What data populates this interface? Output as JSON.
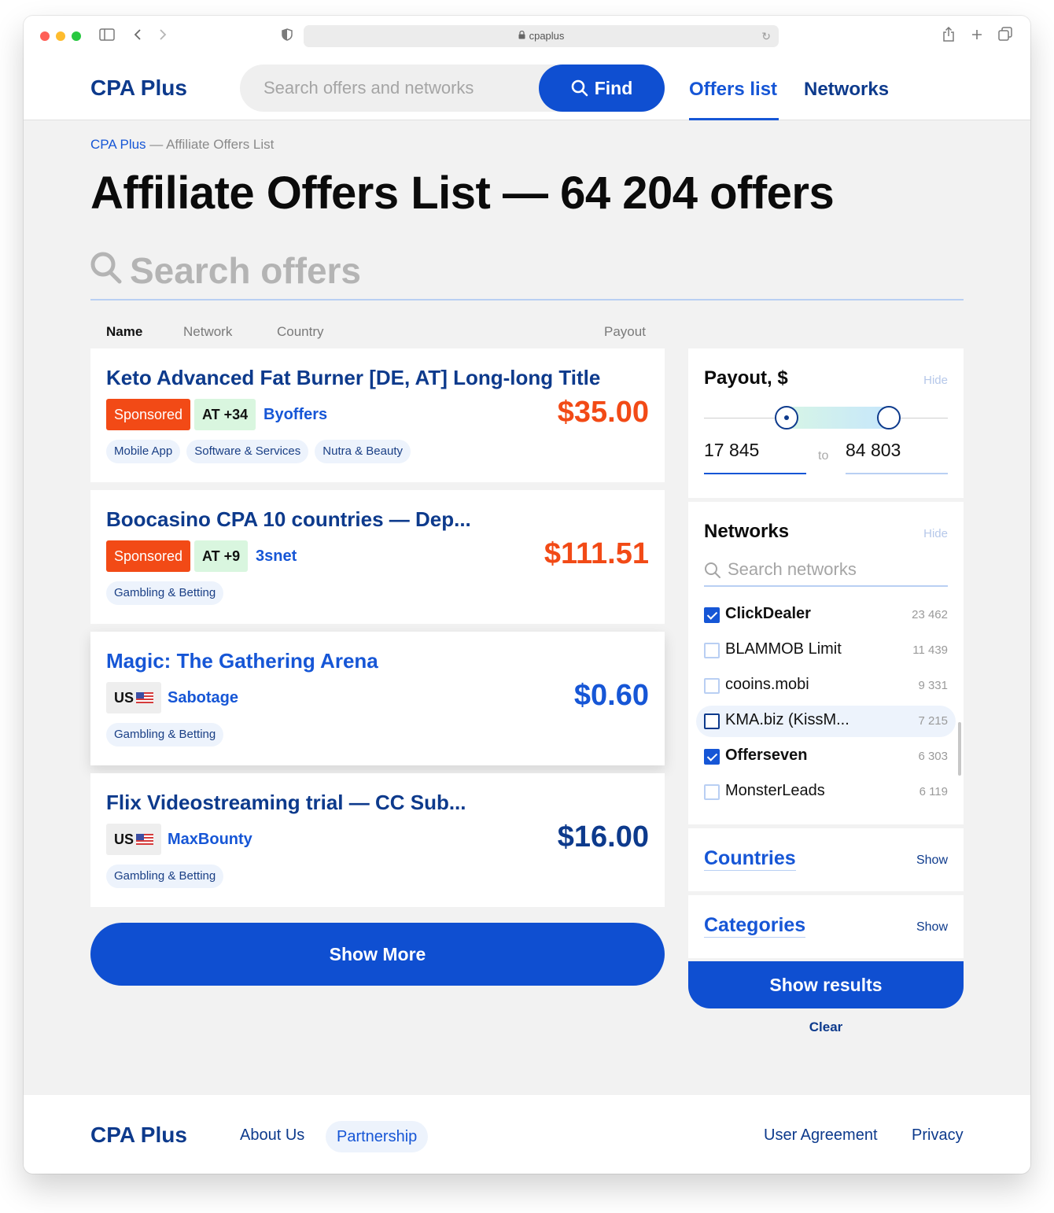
{
  "browser": {
    "url": "cpaplus",
    "traffic_colors": [
      "#ff5f57",
      "#febc2e",
      "#28c840"
    ]
  },
  "header": {
    "logo": "CPA Plus",
    "search_placeholder": "Search offers and networks",
    "find_label": "Find",
    "nav": [
      {
        "label": "Offers list",
        "active": true
      },
      {
        "label": "Networks",
        "active": false
      }
    ]
  },
  "breadcrumb": {
    "home": "CPA Plus",
    "current": " — Affiliate Offers List"
  },
  "page": {
    "title": "Affiliate Offers List — 64 204 offers",
    "search_placeholder": "Search offers"
  },
  "sort_columns": [
    "Name",
    "Network",
    "Country",
    "Payout"
  ],
  "offers": [
    {
      "title": "Keto Advanced Fat Burner [DE, AT] Long-long Title",
      "sponsored": "Sponsored",
      "geo": "AT +34",
      "network": "Byoffers",
      "payout": "$35.00",
      "tags": [
        "Mobile App",
        "Software & Services",
        "Nutra & Beauty"
      ]
    },
    {
      "title": "Boocasino CPA 10 countries — Dep...",
      "sponsored": "Sponsored",
      "geo": "AT +9",
      "network": "3snet",
      "payout": "$111.51",
      "tags": [
        "Gambling & Betting"
      ]
    },
    {
      "title": "Magic: The Gathering Arena",
      "geo": "US",
      "network": "Sabotage",
      "payout": "$0.60",
      "tags": [
        "Gambling & Betting"
      ]
    },
    {
      "title": "Flix Videostreaming trial — CC Sub...",
      "geo": "US",
      "network": "MaxBounty",
      "payout": "$16.00",
      "tags": [
        "Gambling & Betting"
      ]
    }
  ],
  "show_more_label": "Show More",
  "filters": {
    "payout": {
      "title": "Payout, $",
      "toggle": "Hide",
      "from": "17 845",
      "separator": "to",
      "to": "84 803"
    },
    "networks": {
      "title": "Networks",
      "toggle": "Hide",
      "search_placeholder": "Search networks",
      "items": [
        {
          "name": "ClickDealer",
          "count": "23 462",
          "checked": true
        },
        {
          "name": "BLAMMOB Limit",
          "count": "11 439",
          "checked": false
        },
        {
          "name": "cooins.mobi",
          "count": "9 331",
          "checked": false
        },
        {
          "name": "KMA.biz (KissM...",
          "count": "7 215",
          "checked": false
        },
        {
          "name": "Offerseven",
          "count": "6 303",
          "checked": true
        },
        {
          "name": "MonsterLeads",
          "count": "6 119",
          "checked": false
        }
      ]
    },
    "countries": {
      "title": "Countries",
      "toggle": "Show"
    },
    "categories": {
      "title": "Categories",
      "toggle": "Show"
    },
    "show_results_label": "Show results",
    "clear_label": "Clear"
  },
  "footer": {
    "logo": "CPA Plus",
    "links": [
      "About Us",
      "Partnership",
      "User Agreement",
      "Privacy"
    ]
  }
}
